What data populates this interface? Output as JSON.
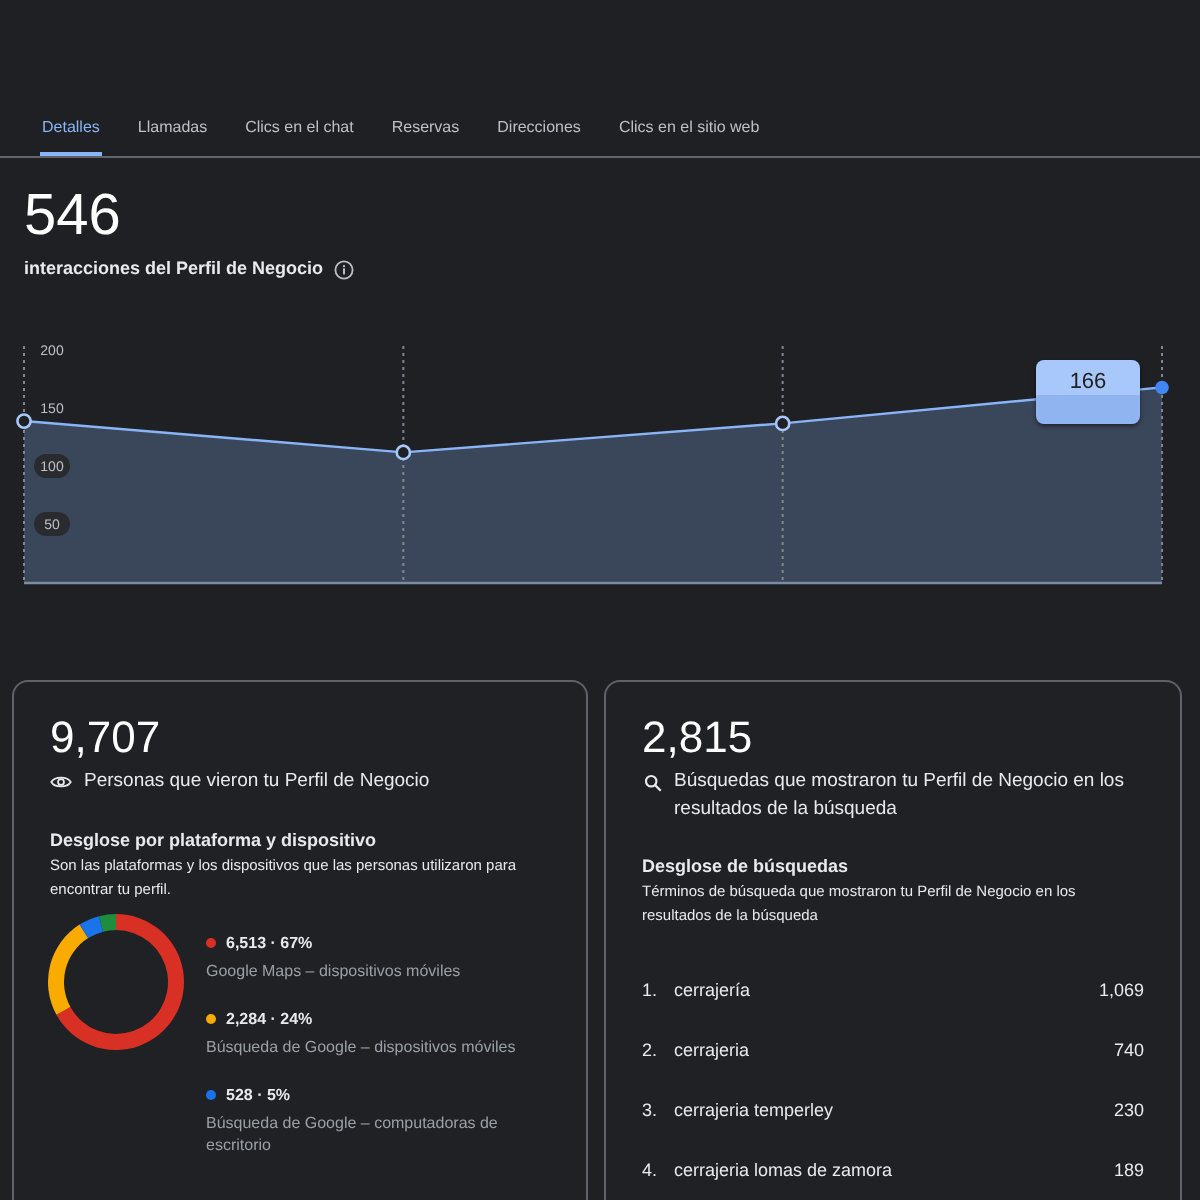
{
  "tabs": [
    {
      "label": "Detalles",
      "selected": true
    },
    {
      "label": "Llamadas",
      "selected": false
    },
    {
      "label": "Clics en el chat",
      "selected": false
    },
    {
      "label": "Reservas",
      "selected": false
    },
    {
      "label": "Direcciones",
      "selected": false
    },
    {
      "label": "Clics en el sitio web",
      "selected": false
    }
  ],
  "summary": {
    "value": "546",
    "caption": "interacciones del Perfil de Negocio"
  },
  "chart": {
    "chart_data": {
      "type": "area",
      "values": [
        137,
        110,
        135,
        166
      ],
      "ylim": [
        0,
        200
      ],
      "yticks": [
        50,
        100,
        150,
        200
      ],
      "annotations": [
        "166"
      ]
    }
  },
  "views_card": {
    "value": "9,707",
    "caption": "Personas que vieron tu Perfil de Negocio",
    "section_title": "Desglose por plataforma y dispositivo",
    "section_description": "Son las plataformas y los dispositivos que las personas utilizaron para encontrar tu perfil.",
    "donut": {
      "chart_data": {
        "type": "donut",
        "values": [
          67,
          24,
          5,
          4
        ],
        "colors": [
          "#d93025",
          "#f9ab00",
          "#1a73e8",
          "#1e8e3e"
        ]
      }
    },
    "legend": [
      {
        "value": "6,513 · 67%",
        "label": "Google Maps – dispositivos móviles",
        "color": "#d93025"
      },
      {
        "value": "2,284 · 24%",
        "label": "Búsqueda de Google – dispositivos móviles",
        "color": "#f9ab00"
      },
      {
        "value": "528 · 5%",
        "label": "Búsqueda de Google – computadoras de escritorio",
        "color": "#1a73e8"
      }
    ]
  },
  "searches_card": {
    "value": "2,815",
    "caption": "Búsquedas que mostraron tu Perfil de Negocio en los resultados de la búsqueda",
    "section_title": "Desglose de búsquedas",
    "section_description": "Términos de búsqueda que mostraron tu Perfil de Negocio en los resultados de la búsqueda",
    "terms": [
      {
        "rank": "1.",
        "term": "cerrajería",
        "count": "1,069"
      },
      {
        "rank": "2.",
        "term": "cerrajeria",
        "count": "740"
      },
      {
        "rank": "3.",
        "term": "cerrajeria temperley",
        "count": "230"
      },
      {
        "rank": "4.",
        "term": "cerrajeria lomas de zamora",
        "count": "189"
      }
    ]
  }
}
